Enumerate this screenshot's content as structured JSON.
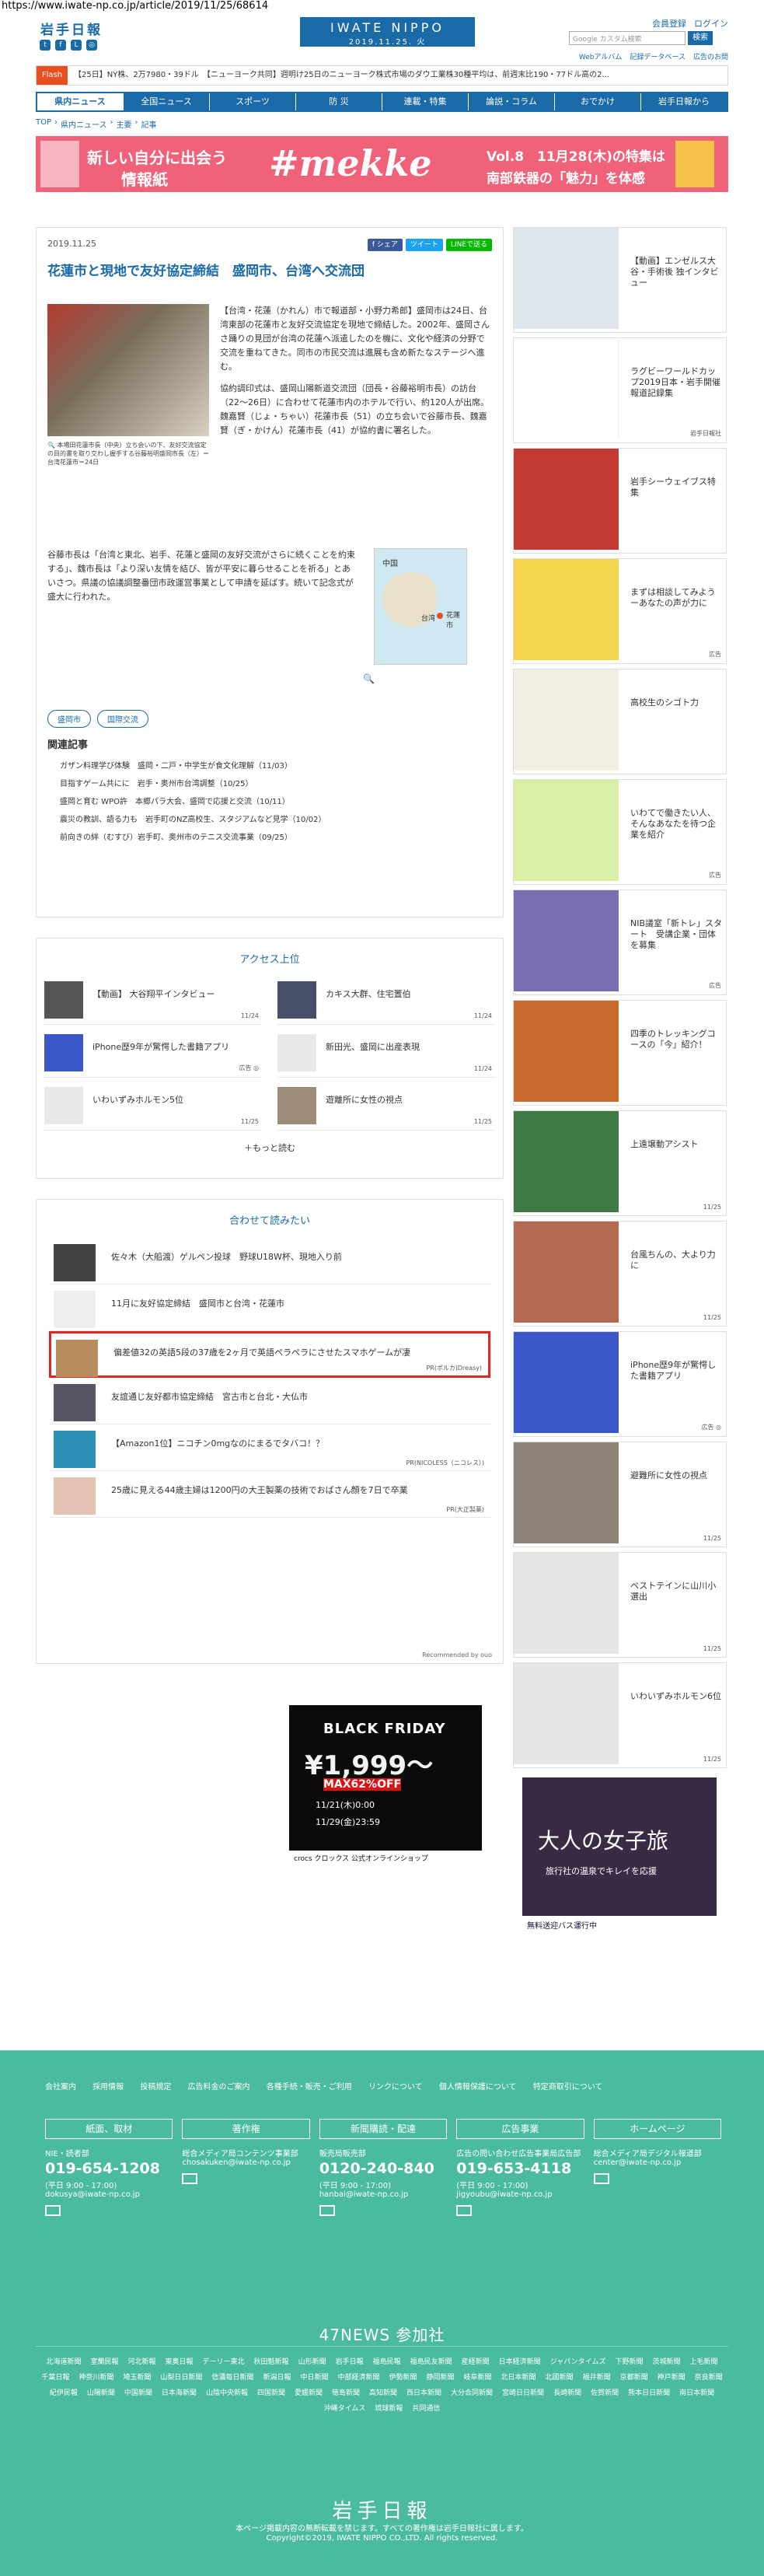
{
  "browser": {
    "url": "https://www.iwate-np.co.jp/article/2019/11/25/68614"
  },
  "header": {
    "logo": "岩手日報",
    "center_title": "IWATE NIPPO",
    "center_date": "2019.11.25. 火",
    "member": "会員登録",
    "login": "ログイン",
    "search_placeholder": "Google カスタム検索",
    "search_button": "検索",
    "sublinks": [
      "Webアルバム",
      "記録データベース",
      "広告のお問"
    ],
    "socials": [
      "twitter-icon",
      "facebook-icon",
      "line-icon",
      "instagram-icon"
    ]
  },
  "flash": {
    "tag": "Flash",
    "text": "【25日】NY株、2万7980・39ドル　【ニューヨーク共同】週明け25日のニューヨーク株式市場のダウ工業株30種平均は、前週末比190・77ドル高の2..."
  },
  "nav": [
    "県内ニュース",
    "全国ニュース",
    "スポーツ",
    "防 災",
    "連載・特集",
    "論説・コラム",
    "おでかけ",
    "岩手日報から"
  ],
  "breadcrumb": [
    "TOP",
    "›",
    "県内ニュース",
    "›",
    "主要",
    "›",
    "記事"
  ],
  "banner": {
    "left1": "新しい自分に出会う",
    "left2": "情報紙",
    "logo": "#mekke",
    "right1": "Vol.8　11月28(木)の特集は",
    "right2": "南部鉄器の「魅力」を体感"
  },
  "article": {
    "date": "2019.11.25",
    "share": [
      "f シェア",
      "ツイート",
      "LINEで送る"
    ],
    "headline": "花蓮市と現地で友好協定締結　盛岡市、台湾へ交流団",
    "caption": "本場田花蓮市長（中央）立ち会いの下、友好交流協定の目的書を取り交わし握手する谷藤裕明盛岡市長（左）＝台湾花蓮市＝24日",
    "body1": "【台湾・花蓮（かれん）市で報道部・小野力希郎】盛岡市は24日、台湾東部の花蓮市と友好交流協定を現地で締結した。2002年、盛岡さんさ踊りの見団が台湾の花蓮へ派遣したのを機に、文化や経済の分野で交流を重ねてきた。同市の市民交流は進展も含め新たなステージへ進む。",
    "body1b": "協約調印式は、盛岡山陽新道交流団（団長・谷藤裕明市長）の訪台（22～26日）に合わせて花蓮市内のホテルで行い、約120人が出席。魏嘉賢（じょ・ちゃい）花蓮市長（51）の立ち会いで谷藤市長、魏嘉賢（ぎ・かけん）花蓮市長（41）が協約書に署名した。",
    "body2": "谷藤市長は「台湾と東北、岩手、花蓮と盛岡の友好交流がさらに続くことを約束する」、魏市長は「より深い友情を結び、皆が平安に暮らせることを祈る」とあいさつ。県議の協議調整番団市政運営事業として申請を延ばす。続いて記念式が盛大に行われた。",
    "map": {
      "china": "中国",
      "taiwan": "台湾",
      "hualien": "花蓮市"
    },
    "tags": [
      "盛岡市",
      "国際交流"
    ],
    "related_title": "関連記事",
    "related": [
      "ガザン料理学び体験　盛岡・二戸・中学生が食文化理解（11/03）",
      "目指すゲーム共にに　岩手・奥州市台湾調整（10/25）",
      "盛岡と育む WPO許　本郷パラ大会、盛岡で応援と交流（10/11）",
      "震災の教訓、語る力も　岩手町のNZ高校生、スタジアムなど見学（10/02）",
      "前向きの絆（むすび）岩手町、奥州市のテニス交流事業（09/25）"
    ]
  },
  "access": {
    "title": "アクセス上位",
    "items": [
      {
        "title": "【動画】 大谷翔平インタビュー",
        "date": "11/24"
      },
      {
        "title": "カキス大群、住宅置伯",
        "date": "11/24"
      },
      {
        "title": "iPhone歴9年が驚愕した書籍アプリ",
        "date": "広告 ◎"
      },
      {
        "title": "新田光、盛岡に出産表現",
        "date": "11/24"
      },
      {
        "title": "いわいずみホルモン5位",
        "date": "11/25"
      },
      {
        "title": "遊離所に女性の視点",
        "date": "11/25"
      }
    ],
    "more": "＋もっと読む"
  },
  "recommend": {
    "title": "合わせて読みたい",
    "items": [
      {
        "title": "佐々木（大船渡）ゲルペン投球　野球U18W杯、現地入り前",
        "src": ""
      },
      {
        "title": "11月に友好協定締結　盛岡市と台湾・花蓮市",
        "src": ""
      },
      {
        "title": "偏差値32の英語5段の37歳を2ヶ月で英語ペラペラにさせたスマホゲームが凄",
        "src": "PR(ポルカ)Dreasy)"
      },
      {
        "title": "友誼通じ友好都市協定締結　宮古市と台北・大仏市",
        "src": ""
      },
      {
        "title": "【Amazon1位】ニコチン0mgなのにまるでタバコ！？",
        "src": "PR(NICOLESS（ニコレス）)"
      },
      {
        "title": "25歳に見える44歳主婦は1200円の大王製薬の技術でおばさん顔を7日で卒業",
        "src": "PR(大正製薬)"
      }
    ],
    "powered": "Recommended by ouo"
  },
  "ad_bottom": {
    "t1": "BLACK FRIDAY",
    "t2": "¥1,999～",
    "t3": "MAX62%OFF",
    "t4": "11/21(木)0:00",
    "t5": "11/29(金)23:59",
    "t6": "crocs クロックス 公式オンラインショップ"
  },
  "sidebar": {
    "items": [
      {
        "title": "【動画】エンゼルス大谷・手術後 独インタビュー",
        "date": ""
      },
      {
        "title": "ラグビーワールドカップ2019日本・岩手開催報道記録集",
        "date": "岩手日報社"
      },
      {
        "title": "岩手シーウェイブス特集",
        "date": ""
      },
      {
        "title": "まずは相談してみようーあなたの声が力に",
        "date": "広告"
      },
      {
        "title": "高校生のシゴト力",
        "date": ""
      },
      {
        "title": "いわてで働きたい人、そんなあなたを待つ企業を紹介",
        "date": "広告"
      },
      {
        "title": "NIB議室「新トレ」スタート　受講企業・団体を募集",
        "date": "広告"
      },
      {
        "title": "四季のトレッキングコースの「今」紹介！",
        "date": ""
      },
      {
        "title": "上遠壌動アシスト",
        "date": "11/25"
      },
      {
        "title": "台風ちんの、大より力に",
        "date": "11/25"
      },
      {
        "title": "iPhone歴9年が驚愕した書籍アプリ",
        "date": "広告 ◎"
      },
      {
        "title": "避難所に女性の視点",
        "date": "11/25"
      },
      {
        "title": "ベストテインに山川小選出",
        "date": "11/25"
      },
      {
        "title": "いわいずみホルモン6位",
        "date": "11/25"
      }
    ],
    "ad": {
      "title": "大人の女子旅",
      "sub": "旅行社の温泉でキレイを応援",
      "bottom": "無料送迎バス運行中"
    }
  },
  "footer": {
    "links": [
      "会社案内",
      "採用情報",
      "投稿規定",
      "広告料金のご案内",
      "各種手続・販売・ご利用",
      "リンクについて",
      "個人情報保護について",
      "特定商取引について"
    ],
    "cols": [
      {
        "head": "紙面、取材",
        "sub": "NIE・読者部",
        "tel": "019-654-1208",
        "hours": "(平日 9:00 - 17:00)",
        "mail": "dokusya@iwate-np.co.jp"
      },
      {
        "head": "著作権",
        "sub": "総合メディア局コンテンツ事業部",
        "tel": "",
        "hours": "",
        "mail": "chosakuken@iwate-np.co.jp"
      },
      {
        "head": "新聞購読・配達",
        "sub": "販売局販売部",
        "tel": "0120-240-840",
        "hours": "(平日 9:00 - 17:00)",
        "mail": "hanbai@iwate-np.co.jp"
      },
      {
        "head": "広告事業",
        "sub": "広告の問い合わせ広告事業局広告部",
        "tel": "019-653-4118",
        "hours": "(平日 9:00 - 17:00)",
        "mail": "jigyoubu@iwate-np.co.jp"
      },
      {
        "head": "ホームページ",
        "sub": "総合メディア局デジタル報道部",
        "tel": "",
        "hours": "",
        "mail": "center@iwate-np.co.jp"
      }
    ],
    "n47": "47NEWS 参加社",
    "papers": [
      "北海道新聞",
      "室蘭民報",
      "河北新報",
      "東奥日報",
      "デーリー東北",
      "秋田魁新報",
      "山形新聞",
      "岩手日報",
      "福島民報",
      "福島民友新聞",
      "産経新聞",
      "日本経済新聞",
      "ジャパンタイムズ",
      "下野新聞",
      "茨城新聞",
      "上毛新聞",
      "千葉日報",
      "神奈川新聞",
      "埼玉新聞",
      "山梨日日新聞",
      "信濃毎日新聞",
      "新潟日報",
      "中日新聞",
      "中部経済新聞",
      "伊勢新聞",
      "静岡新聞",
      "岐阜新聞",
      "北日本新聞",
      "北國新聞",
      "福井新聞",
      "京都新聞",
      "神戸新聞",
      "奈良新聞",
      "紀伊民報",
      "山陽新聞",
      "中国新聞",
      "日本海新聞",
      "山陰中央新報",
      "四国新聞",
      "愛媛新聞",
      "徳島新聞",
      "高知新聞",
      "西日本新聞",
      "大分合同新聞",
      "宮崎日日新聞",
      "長崎新聞",
      "佐賀新聞",
      "熊本日日新聞",
      "南日本新聞",
      "沖縄タイムス",
      "琉球新報",
      "共同通信"
    ],
    "logo": "岩手日報",
    "copy1": "本ページ掲載内容の無断転載を禁じます。すべての著作権は岩手日報社に属します。",
    "copy2": "Copyright©2019, IWATE NIPPO CO.,LTD. All rights reserved."
  }
}
